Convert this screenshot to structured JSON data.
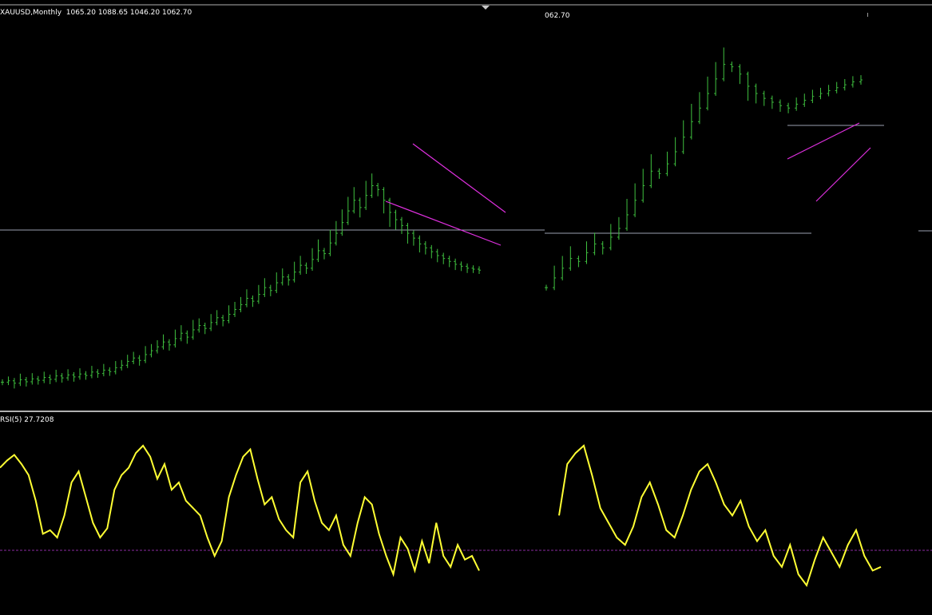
{
  "window": {
    "symbol_label": "XAUUSD,Monthly  1065.20 1088.65 1046.20 1062.70",
    "right_clip_label": "062.70",
    "rsi_label": "RSI(5) 27.7208"
  },
  "colors": {
    "background": "#000000",
    "candle": "#3fc03f",
    "rsi_line": "#ffff33",
    "trendline": "#e030e0",
    "level_line": "#9aa0b0",
    "rsi_level": "#8a2aa0",
    "divider": "#b0b0b0"
  },
  "chart_data": [
    {
      "type": "bar",
      "panel": "price-left",
      "series": [
        {
          "values": [
            1095,
            1098,
            1093,
            1100,
            1096,
            1102,
            1099,
            1105,
            1101,
            1108,
            1104,
            1110,
            1106,
            1112,
            1109,
            1116,
            1113,
            1120,
            1117,
            1125,
            1130,
            1138,
            1145,
            1140,
            1152,
            1160,
            1168,
            1178,
            1172,
            1185,
            1196,
            1188,
            1203,
            1212,
            1206,
            1218,
            1228,
            1222,
            1235,
            1245,
            1255,
            1268,
            1262,
            1276,
            1290,
            1284,
            1300,
            1312,
            1306,
            1322,
            1336,
            1330,
            1348,
            1366,
            1360,
            1382,
            1402,
            1424,
            1448,
            1470,
            1455,
            1480,
            1500,
            1492,
            1470,
            1445,
            1430,
            1418,
            1402,
            1392,
            1380,
            1372,
            1364,
            1356,
            1350,
            1344,
            1338,
            1334,
            1330,
            1328,
            1326
          ]
        }
      ],
      "ylim": [
        1040,
        1830
      ]
    },
    {
      "type": "bar",
      "panel": "price-right",
      "series": [
        {
          "values": [
            1290,
            1310,
            1330,
            1350,
            1344,
            1362,
            1380,
            1372,
            1394,
            1412,
            1440,
            1470,
            1500,
            1530,
            1525,
            1545,
            1570,
            1600,
            1632,
            1660,
            1690,
            1720,
            1750,
            1745,
            1730,
            1705,
            1690,
            1680,
            1672,
            1665,
            1660,
            1668,
            1676,
            1684,
            1690,
            1696,
            1702,
            1708,
            1714,
            1718
          ]
        }
      ],
      "ylim": [
        1040,
        1830
      ]
    },
    {
      "type": "line",
      "panel": "rsi-left",
      "series": [
        {
          "values": [
            78,
            82,
            85,
            80,
            74,
            60,
            42,
            44,
            40,
            52,
            70,
            76,
            62,
            48,
            40,
            45,
            66,
            74,
            78,
            86,
            90,
            84,
            72,
            80,
            66,
            70,
            60,
            56,
            52,
            40,
            30,
            38,
            62,
            74,
            84,
            88,
            72,
            58,
            62,
            50,
            44,
            40,
            70,
            76,
            60,
            48,
            44,
            52,
            36,
            30,
            48,
            62,
            58,
            42,
            30,
            20,
            40,
            34,
            22,
            38,
            26,
            48,
            30,
            24,
            36,
            28,
            30,
            22
          ]
        }
      ],
      "ylim": [
        0,
        100
      ]
    },
    {
      "type": "line",
      "panel": "rsi-right",
      "series": [
        {
          "values": [
            52,
            80,
            86,
            90,
            74,
            56,
            48,
            40,
            36,
            46,
            62,
            70,
            58,
            44,
            40,
            52,
            66,
            76,
            80,
            70,
            58,
            52,
            60,
            46,
            38,
            44,
            30,
            24,
            36,
            20,
            14,
            28,
            40,
            32,
            24,
            36,
            44,
            30,
            22,
            24
          ]
        }
      ],
      "ylim": [
        0,
        100
      ]
    }
  ]
}
